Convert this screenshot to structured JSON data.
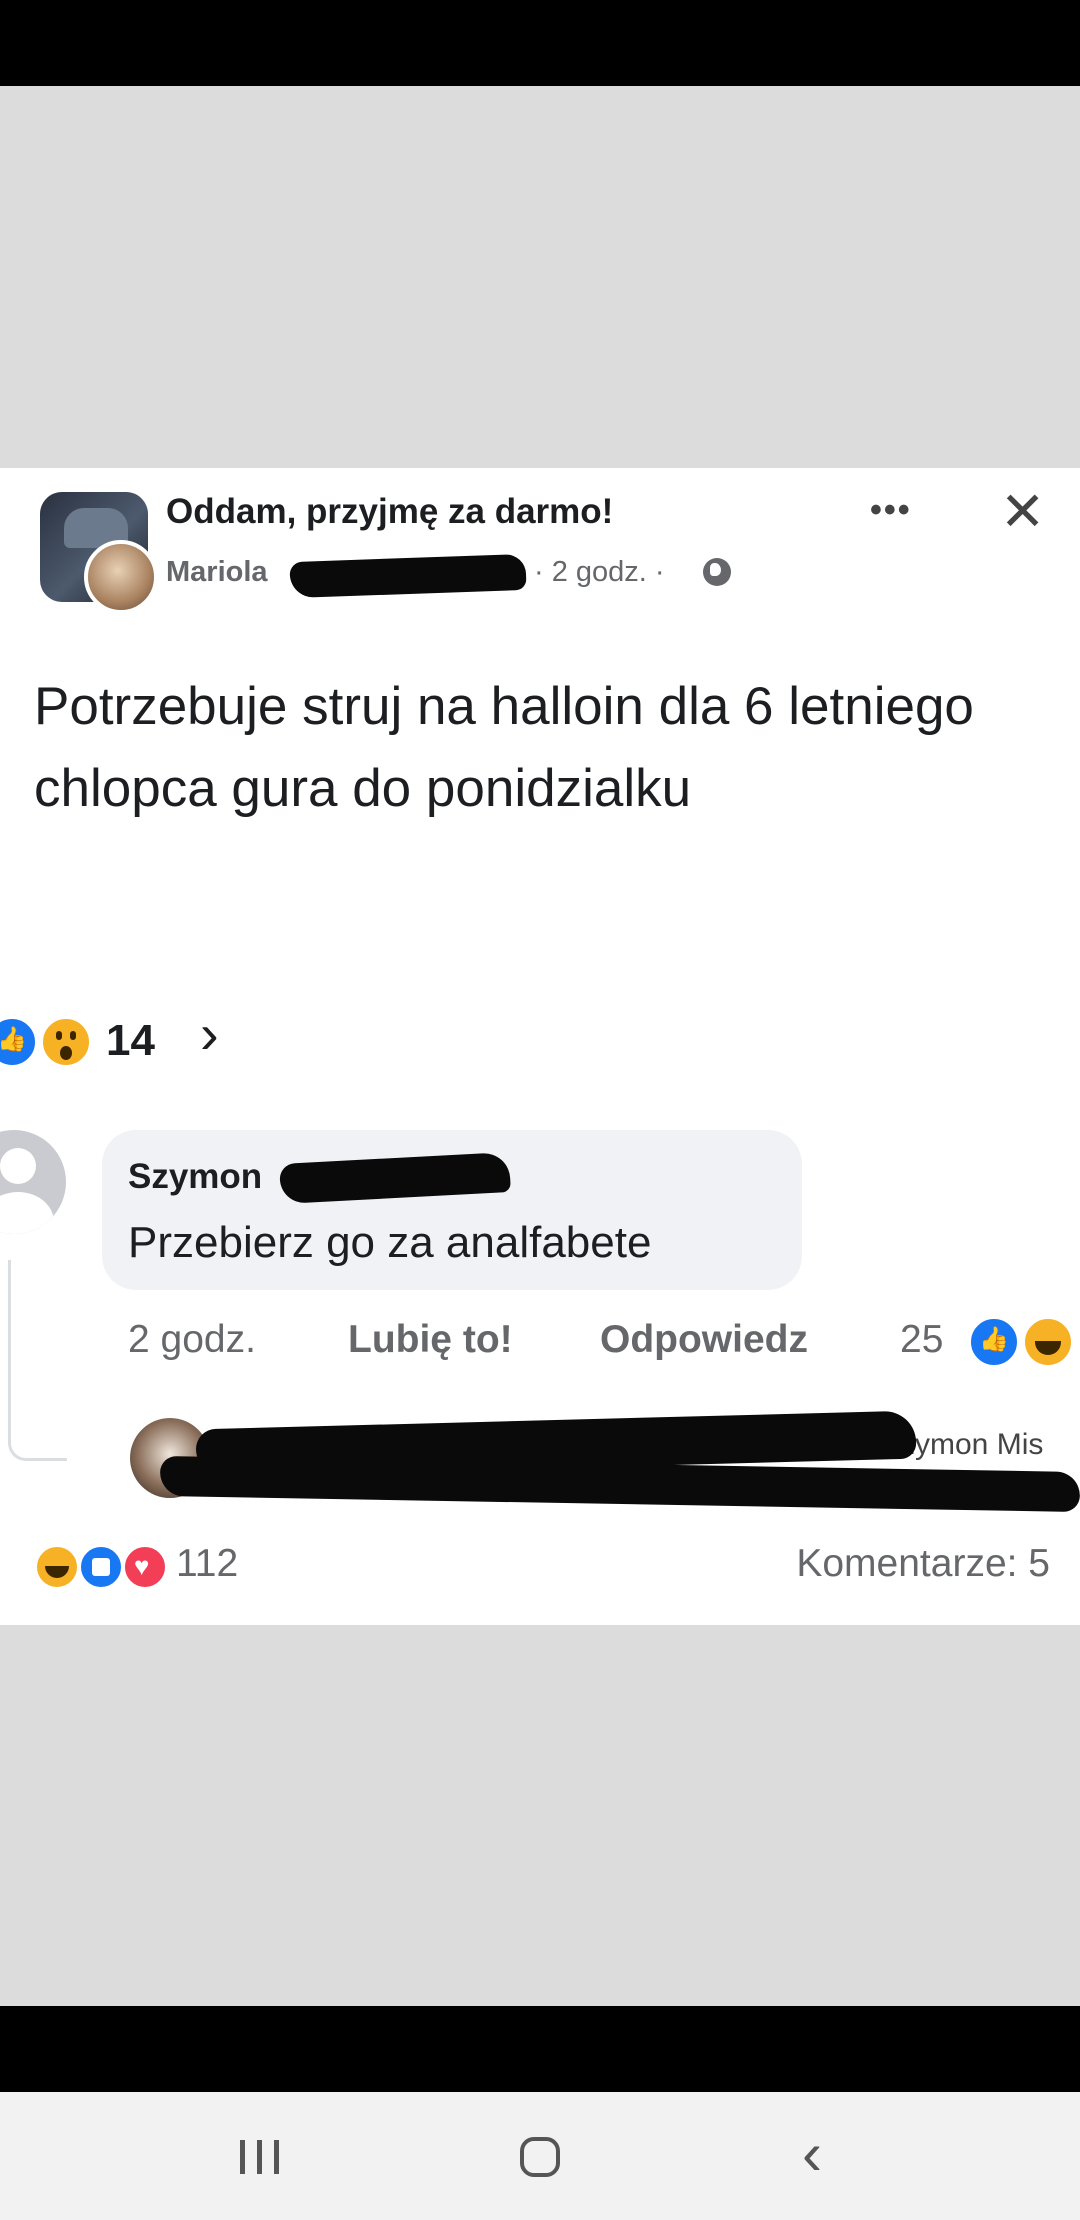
{
  "post": {
    "group_name": "Oddam, przyjmę za darmo!",
    "author_first_name": "Mariola",
    "time": "· 2 godz. ·",
    "icons": {
      "more": "more-dots-icon",
      "close": "close-icon",
      "audience": "globe-icon"
    },
    "text": "Potrzebuje struj na halloin dla 6 letniego chlopca gura do ponidzialku",
    "reactions": {
      "icons": [
        "like-reaction-icon",
        "wow-reaction-icon"
      ],
      "count": "14",
      "chevron": "›"
    }
  },
  "comment": {
    "author_first_name": "Szymon",
    "text": "Przebierz go za analfabete",
    "time": "2 godz.",
    "like_label": "Lubię to!",
    "reply_label": "Odpowiedz",
    "reaction_count": "25",
    "reaction_icons": [
      "like-reaction-icon",
      "haha-reaction-icon"
    ]
  },
  "reply_preview": {
    "visible_name_fragment": "Szymon Mis"
  },
  "footer": {
    "reaction_icons": [
      "haha-reaction-icon",
      "like-reaction-icon",
      "love-reaction-icon"
    ],
    "reaction_count": "112",
    "comments_label": "Komentarze: 5"
  },
  "colors": {
    "accent": "#1877f2",
    "secondary_text": "#65676b",
    "bubble": "#f0f2f5",
    "love": "#f33e58",
    "haha": "#f7b125"
  }
}
